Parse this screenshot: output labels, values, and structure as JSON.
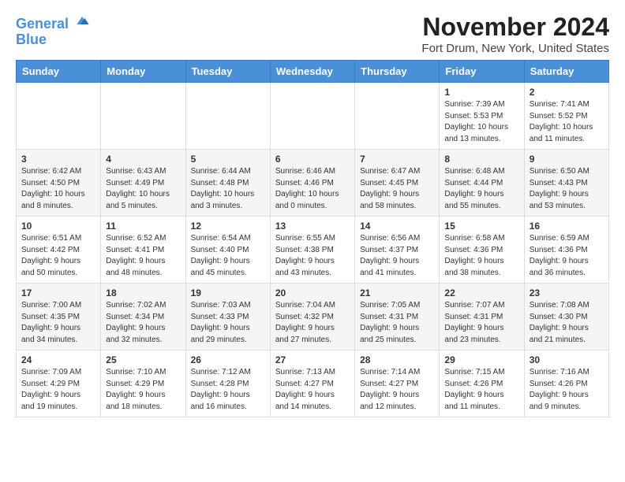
{
  "logo": {
    "line1": "General",
    "line2": "Blue"
  },
  "title": "November 2024",
  "location": "Fort Drum, New York, United States",
  "headers": [
    "Sunday",
    "Monday",
    "Tuesday",
    "Wednesday",
    "Thursday",
    "Friday",
    "Saturday"
  ],
  "weeks": [
    [
      {
        "day": "",
        "info": ""
      },
      {
        "day": "",
        "info": ""
      },
      {
        "day": "",
        "info": ""
      },
      {
        "day": "",
        "info": ""
      },
      {
        "day": "",
        "info": ""
      },
      {
        "day": "1",
        "info": "Sunrise: 7:39 AM\nSunset: 5:53 PM\nDaylight: 10 hours and 13 minutes."
      },
      {
        "day": "2",
        "info": "Sunrise: 7:41 AM\nSunset: 5:52 PM\nDaylight: 10 hours and 11 minutes."
      }
    ],
    [
      {
        "day": "3",
        "info": "Sunrise: 6:42 AM\nSunset: 4:50 PM\nDaylight: 10 hours and 8 minutes."
      },
      {
        "day": "4",
        "info": "Sunrise: 6:43 AM\nSunset: 4:49 PM\nDaylight: 10 hours and 5 minutes."
      },
      {
        "day": "5",
        "info": "Sunrise: 6:44 AM\nSunset: 4:48 PM\nDaylight: 10 hours and 3 minutes."
      },
      {
        "day": "6",
        "info": "Sunrise: 6:46 AM\nSunset: 4:46 PM\nDaylight: 10 hours and 0 minutes."
      },
      {
        "day": "7",
        "info": "Sunrise: 6:47 AM\nSunset: 4:45 PM\nDaylight: 9 hours and 58 minutes."
      },
      {
        "day": "8",
        "info": "Sunrise: 6:48 AM\nSunset: 4:44 PM\nDaylight: 9 hours and 55 minutes."
      },
      {
        "day": "9",
        "info": "Sunrise: 6:50 AM\nSunset: 4:43 PM\nDaylight: 9 hours and 53 minutes."
      }
    ],
    [
      {
        "day": "10",
        "info": "Sunrise: 6:51 AM\nSunset: 4:42 PM\nDaylight: 9 hours and 50 minutes."
      },
      {
        "day": "11",
        "info": "Sunrise: 6:52 AM\nSunset: 4:41 PM\nDaylight: 9 hours and 48 minutes."
      },
      {
        "day": "12",
        "info": "Sunrise: 6:54 AM\nSunset: 4:40 PM\nDaylight: 9 hours and 45 minutes."
      },
      {
        "day": "13",
        "info": "Sunrise: 6:55 AM\nSunset: 4:38 PM\nDaylight: 9 hours and 43 minutes."
      },
      {
        "day": "14",
        "info": "Sunrise: 6:56 AM\nSunset: 4:37 PM\nDaylight: 9 hours and 41 minutes."
      },
      {
        "day": "15",
        "info": "Sunrise: 6:58 AM\nSunset: 4:36 PM\nDaylight: 9 hours and 38 minutes."
      },
      {
        "day": "16",
        "info": "Sunrise: 6:59 AM\nSunset: 4:36 PM\nDaylight: 9 hours and 36 minutes."
      }
    ],
    [
      {
        "day": "17",
        "info": "Sunrise: 7:00 AM\nSunset: 4:35 PM\nDaylight: 9 hours and 34 minutes."
      },
      {
        "day": "18",
        "info": "Sunrise: 7:02 AM\nSunset: 4:34 PM\nDaylight: 9 hours and 32 minutes."
      },
      {
        "day": "19",
        "info": "Sunrise: 7:03 AM\nSunset: 4:33 PM\nDaylight: 9 hours and 29 minutes."
      },
      {
        "day": "20",
        "info": "Sunrise: 7:04 AM\nSunset: 4:32 PM\nDaylight: 9 hours and 27 minutes."
      },
      {
        "day": "21",
        "info": "Sunrise: 7:05 AM\nSunset: 4:31 PM\nDaylight: 9 hours and 25 minutes."
      },
      {
        "day": "22",
        "info": "Sunrise: 7:07 AM\nSunset: 4:31 PM\nDaylight: 9 hours and 23 minutes."
      },
      {
        "day": "23",
        "info": "Sunrise: 7:08 AM\nSunset: 4:30 PM\nDaylight: 9 hours and 21 minutes."
      }
    ],
    [
      {
        "day": "24",
        "info": "Sunrise: 7:09 AM\nSunset: 4:29 PM\nDaylight: 9 hours and 19 minutes."
      },
      {
        "day": "25",
        "info": "Sunrise: 7:10 AM\nSunset: 4:29 PM\nDaylight: 9 hours and 18 minutes."
      },
      {
        "day": "26",
        "info": "Sunrise: 7:12 AM\nSunset: 4:28 PM\nDaylight: 9 hours and 16 minutes."
      },
      {
        "day": "27",
        "info": "Sunrise: 7:13 AM\nSunset: 4:27 PM\nDaylight: 9 hours and 14 minutes."
      },
      {
        "day": "28",
        "info": "Sunrise: 7:14 AM\nSunset: 4:27 PM\nDaylight: 9 hours and 12 minutes."
      },
      {
        "day": "29",
        "info": "Sunrise: 7:15 AM\nSunset: 4:26 PM\nDaylight: 9 hours and 11 minutes."
      },
      {
        "day": "30",
        "info": "Sunrise: 7:16 AM\nSunset: 4:26 PM\nDaylight: 9 hours and 9 minutes."
      }
    ]
  ]
}
